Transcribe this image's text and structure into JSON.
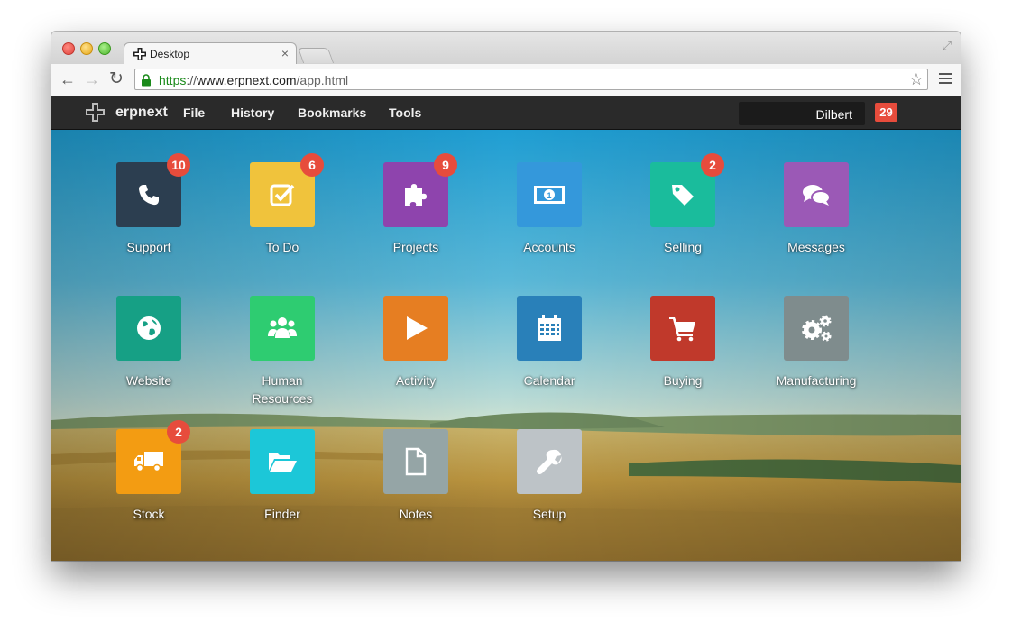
{
  "browser": {
    "tab_title": "Desktop",
    "tab_close": "×",
    "url_scheme": "https",
    "url_sep": "://",
    "url_host": "www.erpnext.com",
    "url_path": "/app.html"
  },
  "appbar": {
    "brand": "erpnext",
    "menus": [
      "File",
      "History",
      "Bookmarks",
      "Tools"
    ],
    "user": "Dilbert",
    "notifications": "29"
  },
  "apps": [
    {
      "label": "Support",
      "color": "#2c3e50",
      "icon": "phone-icon",
      "badge": "10"
    },
    {
      "label": "To Do",
      "color": "#f0c33c",
      "icon": "checkbox-icon",
      "badge": "6"
    },
    {
      "label": "Projects",
      "color": "#8e44ad",
      "icon": "puzzle-icon",
      "badge": "9"
    },
    {
      "label": "Accounts",
      "color": "#3498db",
      "icon": "money-icon",
      "badge": ""
    },
    {
      "label": "Selling",
      "color": "#1abc9c",
      "icon": "tag-icon",
      "badge": "2"
    },
    {
      "label": "Messages",
      "color": "#9b59b6",
      "icon": "chat-icon",
      "badge": ""
    },
    {
      "label": "Website",
      "color": "#16a085",
      "icon": "globe-icon",
      "badge": ""
    },
    {
      "label": "Human Resources",
      "color": "#2ecc71",
      "icon": "group-icon",
      "badge": ""
    },
    {
      "label": "Activity",
      "color": "#e67e22",
      "icon": "play-icon",
      "badge": ""
    },
    {
      "label": "Calendar",
      "color": "#2980b9",
      "icon": "calendar-icon",
      "badge": ""
    },
    {
      "label": "Buying",
      "color": "#c0392b",
      "icon": "cart-icon",
      "badge": ""
    },
    {
      "label": "Manufacturing",
      "color": "#7f8c8d",
      "icon": "gears-icon",
      "badge": ""
    },
    {
      "label": "Stock",
      "color": "#f39c12",
      "icon": "truck-icon",
      "badge": "2"
    },
    {
      "label": "Finder",
      "color": "#1cc7d8",
      "icon": "folder-open-icon",
      "badge": ""
    },
    {
      "label": "Notes",
      "color": "#95a5a6",
      "icon": "file-icon",
      "badge": ""
    },
    {
      "label": "Setup",
      "color": "#bdc3c7",
      "icon": "wrench-icon",
      "badge": ""
    }
  ]
}
